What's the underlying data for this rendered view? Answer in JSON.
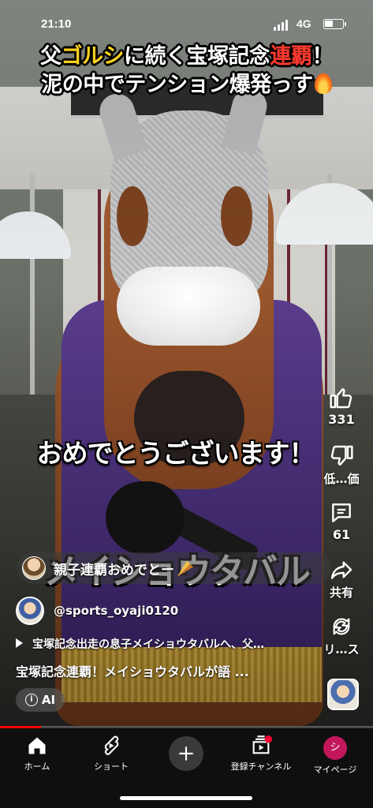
{
  "status_bar": {
    "time": "21:10",
    "network": "4G"
  },
  "video": {
    "headline_line1_pre": "父",
    "headline_line1_accent": "ゴルシ",
    "headline_line1_mid": "に続く宝塚記念",
    "headline_line1_red": "連覇",
    "headline_line1_post": "！",
    "headline_line2": "泥の中でテンション爆発っす",
    "subtitle": "おめでとうございます！",
    "big_caption": "メイショウタバル",
    "progress_fraction": 0.11
  },
  "pinned_comment": {
    "text": "親子連覇おめでとー"
  },
  "actions": {
    "like_count": "331",
    "dislike_label": "低…価",
    "comment_count": "61",
    "share_label": "共有",
    "remix_label": "リ…ス"
  },
  "channel": {
    "handle": "@sports_oyaji0120"
  },
  "related_video": "宝塚記念出走の息子メイショウタバルへ、父…",
  "description": "宝塚記念連覇！メイショウタバルが語 ...",
  "ai_chip": {
    "label": "AI"
  },
  "bottom_nav": {
    "home": "ホーム",
    "shorts": "ショート",
    "subscriptions": "登録チャンネル",
    "you": "マイページ",
    "you_avatar_letter": "シ"
  },
  "colors": {
    "accent_yellow": "#ffd21f",
    "accent_red": "#ff3b2f",
    "progress": "#ff0000",
    "nav_bg": "#0f0f0f"
  }
}
